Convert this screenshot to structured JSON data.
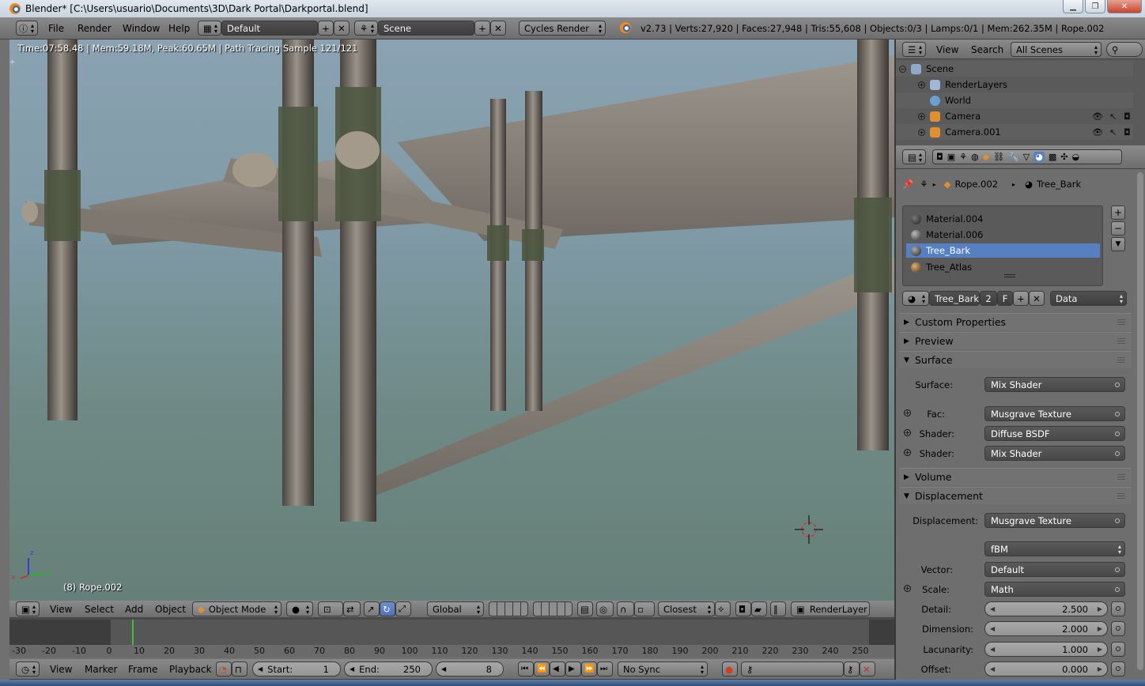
{
  "window": {
    "title": "Blender* [C:\\Users\\usuario\\Documents\\3D\\Dark Portal\\Darkportal.blend]"
  },
  "info_header": {
    "menus": [
      "File",
      "Render",
      "Window",
      "Help"
    ],
    "screen_layout": "Default",
    "scene": "Scene",
    "render_engine": "Cycles Render",
    "stats": "v2.73 | Verts:27,920 | Faces:27,948 | Tris:55,608 | Objects:0/3 | Lamps:0/1 | Mem:262.35M | Rope.002"
  },
  "viewport": {
    "render_info": "Time:07:58.48 | Mem:59.18M, Peak:60.65M | Path Tracing Sample 121/121",
    "object_label": "(8) Rope.002",
    "axis_labels": [
      "x",
      "y",
      "z"
    ]
  },
  "view_header": {
    "menus": [
      "View",
      "Select",
      "Add",
      "Object"
    ],
    "mode": "Object Mode",
    "orientation": "Global",
    "snap": "Closest",
    "render_layer": "RenderLayer"
  },
  "timeline": {
    "ticks": [
      "-30",
      "-20",
      "-10",
      "0",
      "10",
      "20",
      "30",
      "40",
      "50",
      "60",
      "70",
      "80",
      "90",
      "100",
      "110",
      "120",
      "130",
      "140",
      "150",
      "160",
      "170",
      "180",
      "190",
      "200",
      "210",
      "220",
      "230",
      "240",
      "250"
    ],
    "current_frame_value": 8
  },
  "timeline_header": {
    "menus": [
      "View",
      "Marker",
      "Frame",
      "Playback"
    ],
    "start_label": "Start:",
    "start_value": "1",
    "end_label": "End:",
    "end_value": "250",
    "current_frame": "8",
    "sync": "No Sync"
  },
  "outliner": {
    "menus": [
      "View",
      "Search"
    ],
    "filter": "All Scenes",
    "rows": [
      {
        "label": "Scene"
      },
      {
        "label": "RenderLayers"
      },
      {
        "label": "World"
      },
      {
        "label": "Camera"
      },
      {
        "label": "Camera.001"
      }
    ]
  },
  "properties": {
    "breadcrumb_object": "Rope.002",
    "breadcrumb_material": "Tree_Bark",
    "materials": [
      "Material.004",
      "Material.006",
      "Tree_Bark",
      "Tree_Atlas"
    ],
    "selected_material": "Tree_Bark",
    "material_name": "Tree_Bark",
    "users": "2",
    "fake_user": "F",
    "link": "Data",
    "panels": {
      "custom_properties": "Custom Properties",
      "preview": "Preview",
      "surface": "Surface",
      "volume": "Volume",
      "displacement": "Displacement"
    },
    "surface": {
      "surface_label": "Surface:",
      "surface_value": "Mix Shader",
      "fac_label": "Fac:",
      "fac_value": "Musgrave Texture",
      "shader1_label": "Shader:",
      "shader1_value": "Diffuse BSDF",
      "shader2_label": "Shader:",
      "shader2_value": "Mix Shader"
    },
    "displacement": {
      "displacement_label": "Displacement:",
      "displacement_value": "Musgrave Texture",
      "type_value": "fBM",
      "vector_label": "Vector:",
      "vector_value": "Default",
      "scale_label": "Scale:",
      "scale_value": "Math",
      "detail_label": "Detail:",
      "detail_value": "2.500",
      "dimension_label": "Dimension:",
      "dimension_value": "2.000",
      "lacunarity_label": "Lacunarity:",
      "lacunarity_value": "1.000",
      "offset_label": "Offset:",
      "offset_value": "0.000"
    }
  },
  "colors": {
    "selection": "#5680c2",
    "header_bg": "#7c7c7c",
    "panel_bg": "#6e6e6e",
    "frame_cursor": "#3ec23e"
  }
}
